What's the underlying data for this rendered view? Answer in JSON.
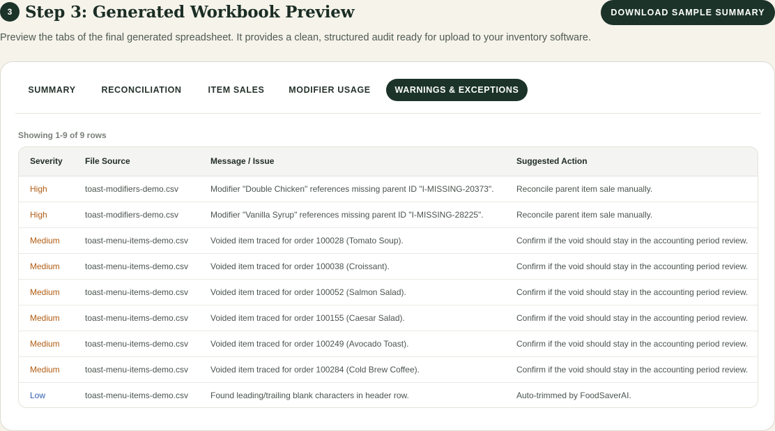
{
  "header": {
    "step_number": "3",
    "title": "Step 3: Generated Workbook Preview",
    "download_label": "DOWNLOAD SAMPLE SUMMARY",
    "subtitle": "Preview the tabs of the final generated spreadsheet. It provides a clean, structured audit ready for upload to your inventory software."
  },
  "tabs": [
    {
      "label": "SUMMARY",
      "active": false
    },
    {
      "label": "RECONCILIATION",
      "active": false
    },
    {
      "label": "ITEM SALES",
      "active": false
    },
    {
      "label": "MODIFIER USAGE",
      "active": false
    },
    {
      "label": "WARNINGS & EXCEPTIONS",
      "active": true
    }
  ],
  "table": {
    "rows_info": "Showing 1-9 of 9 rows",
    "columns": [
      "Severity",
      "File Source",
      "Message / Issue",
      "Suggested Action"
    ],
    "rows": [
      {
        "severity": "High",
        "source": "toast-modifiers-demo.csv",
        "message": "Modifier \"Double Chicken\" references missing parent ID \"I-MISSING-20373\".",
        "action": "Reconcile parent item sale manually."
      },
      {
        "severity": "High",
        "source": "toast-modifiers-demo.csv",
        "message": "Modifier \"Vanilla Syrup\" references missing parent ID \"I-MISSING-28225\".",
        "action": "Reconcile parent item sale manually."
      },
      {
        "severity": "Medium",
        "source": "toast-menu-items-demo.csv",
        "message": "Voided item traced for order 100028 (Tomato Soup).",
        "action": "Confirm if the void should stay in the accounting period review."
      },
      {
        "severity": "Medium",
        "source": "toast-menu-items-demo.csv",
        "message": "Voided item traced for order 100038 (Croissant).",
        "action": "Confirm if the void should stay in the accounting period review."
      },
      {
        "severity": "Medium",
        "source": "toast-menu-items-demo.csv",
        "message": "Voided item traced for order 100052 (Salmon Salad).",
        "action": "Confirm if the void should stay in the accounting period review."
      },
      {
        "severity": "Medium",
        "source": "toast-menu-items-demo.csv",
        "message": "Voided item traced for order 100155 (Caesar Salad).",
        "action": "Confirm if the void should stay in the accounting period review."
      },
      {
        "severity": "Medium",
        "source": "toast-menu-items-demo.csv",
        "message": "Voided item traced for order 100249 (Avocado Toast).",
        "action": "Confirm if the void should stay in the accounting period review."
      },
      {
        "severity": "Medium",
        "source": "toast-menu-items-demo.csv",
        "message": "Voided item traced for order 100284 (Cold Brew Coffee).",
        "action": "Confirm if the void should stay in the accounting period review."
      },
      {
        "severity": "Low",
        "source": "toast-menu-items-demo.csv",
        "message": "Found leading/trailing blank characters in header row.",
        "action": "Auto-trimmed by FoodSaverAI."
      }
    ]
  },
  "colors": {
    "brand_dark": "#1b3329",
    "severity_high": "#b15c12",
    "severity_medium": "#b15c12",
    "severity_low": "#2f5fae"
  }
}
